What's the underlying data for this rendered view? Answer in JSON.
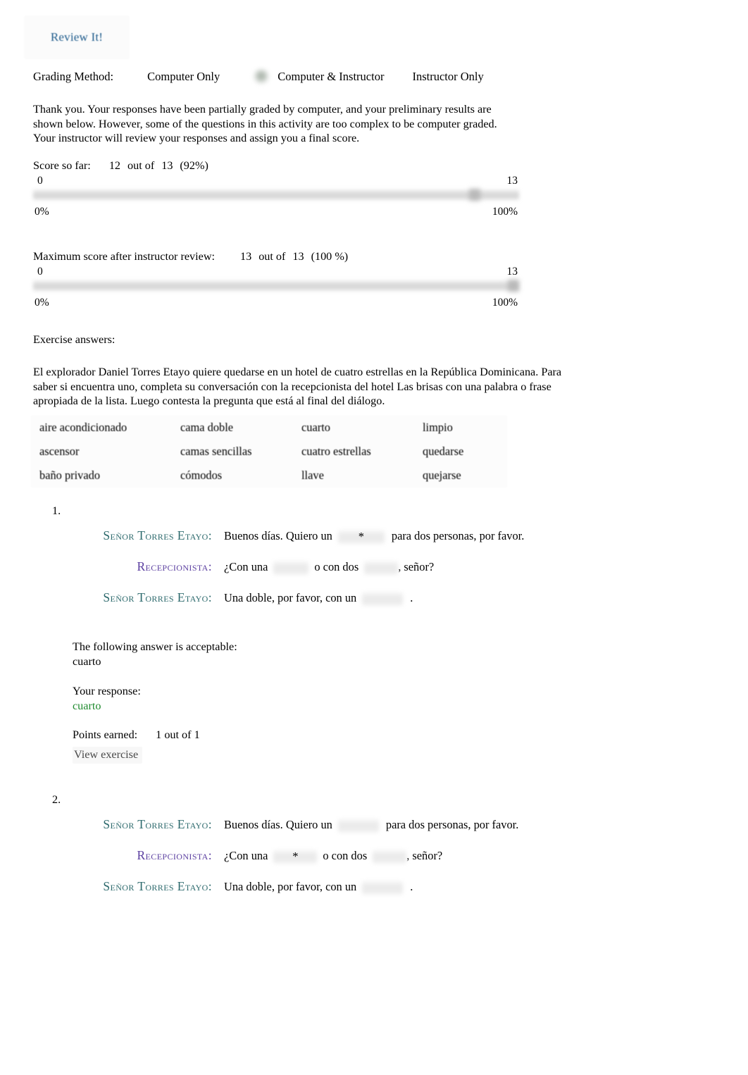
{
  "header": {
    "review_link": "Review It!"
  },
  "grading": {
    "label": "Grading Method:",
    "options": [
      {
        "label": "Computer Only",
        "selected": false
      },
      {
        "label": "Computer & Instructor",
        "selected": true
      },
      {
        "label": "Instructor Only",
        "selected": false
      }
    ]
  },
  "intro": {
    "text": "Thank you. Your responses have been partially graded by computer, and your preliminary results are shown below. However, some of the questions in this activity are too complex to be computer graded. Your instructor will review your responses and assign you a final score."
  },
  "score_so_far": {
    "label": "Score so far:",
    "earned": "12",
    "out_of_word": "out of",
    "total": "13",
    "percent": "(92%)",
    "bar_min": "0",
    "bar_max": "13",
    "pct_min": "0%",
    "pct_max": "100%",
    "fill_percent": 92
  },
  "max_score": {
    "label": "Maximum score after instructor review:",
    "earned": "13",
    "out_of_word": "out of",
    "total": "13",
    "percent": "(100 %)",
    "bar_min": "0",
    "bar_max": "13",
    "pct_min": "0%",
    "pct_max": "100%",
    "fill_percent": 100
  },
  "exercise_answers_heading": "Exercise answers:",
  "prompt": {
    "text": "El explorador Daniel Torres Etayo quiere quedarse en un hotel de cuatro estrellas en la República Dominicana. Para saber si encuentra uno, completa su conversación con la recepcionista del hotel Las brisas con una palabra o frase apropiada de la lista. Luego contesta la pregunta que está al final del diálogo."
  },
  "word_bank": {
    "rows": [
      [
        "aire acondicionado",
        "cama doble",
        "cuarto",
        "limpio"
      ],
      [
        "ascensor",
        "camas sencillas",
        "cuatro estrellas",
        "quedarse"
      ],
      [
        "baño privado",
        "cómodos",
        "llave",
        "quejarse"
      ]
    ]
  },
  "exercises": [
    {
      "number": "1.",
      "lines": [
        {
          "speaker": "Señor Torres Etayo:",
          "speaker_role": "sr",
          "before": "Buenos días. Quiero un",
          "blank_marked": true,
          "star": "*",
          "after": "para dos personas, por favor."
        },
        {
          "speaker": "Recepcionista:",
          "speaker_role": "rc",
          "before": "¿Con una",
          "blank_marked": false,
          "middle": "o con dos",
          "after": ", señor?"
        },
        {
          "speaker": "Señor Torres Etayo:",
          "speaker_role": "sr",
          "before": "Una doble, por favor, con un",
          "blank_marked": false,
          "after": "."
        }
      ],
      "feedback": {
        "acceptable_label": "The following answer is acceptable:",
        "acceptable_value": "cuarto",
        "response_label": "Your response:",
        "response_value": "cuarto",
        "points_label": "Points earned:",
        "points_value": "1 out of 1",
        "view_exercise": "View exercise"
      }
    },
    {
      "number": "2.",
      "lines": [
        {
          "speaker": "Señor Torres Etayo:",
          "speaker_role": "sr",
          "before": "Buenos días. Quiero un",
          "blank_marked": false,
          "after": "para dos personas, por favor."
        },
        {
          "speaker": "Recepcionista:",
          "speaker_role": "rc",
          "before": "¿Con una",
          "blank_marked": true,
          "star": "*",
          "middle": "o con dos",
          "after": ", señor?"
        },
        {
          "speaker": "Señor Torres Etayo:",
          "speaker_role": "sr",
          "before": "Una doble, por favor, con un",
          "blank_marked": false,
          "after": "."
        }
      ]
    }
  ],
  "colors": {
    "link_blue": "#1f5c8c",
    "speaker_teal": "#2d6a6d",
    "speaker_purple": "#5b3fa0",
    "response_green": "#1f8a2e"
  }
}
